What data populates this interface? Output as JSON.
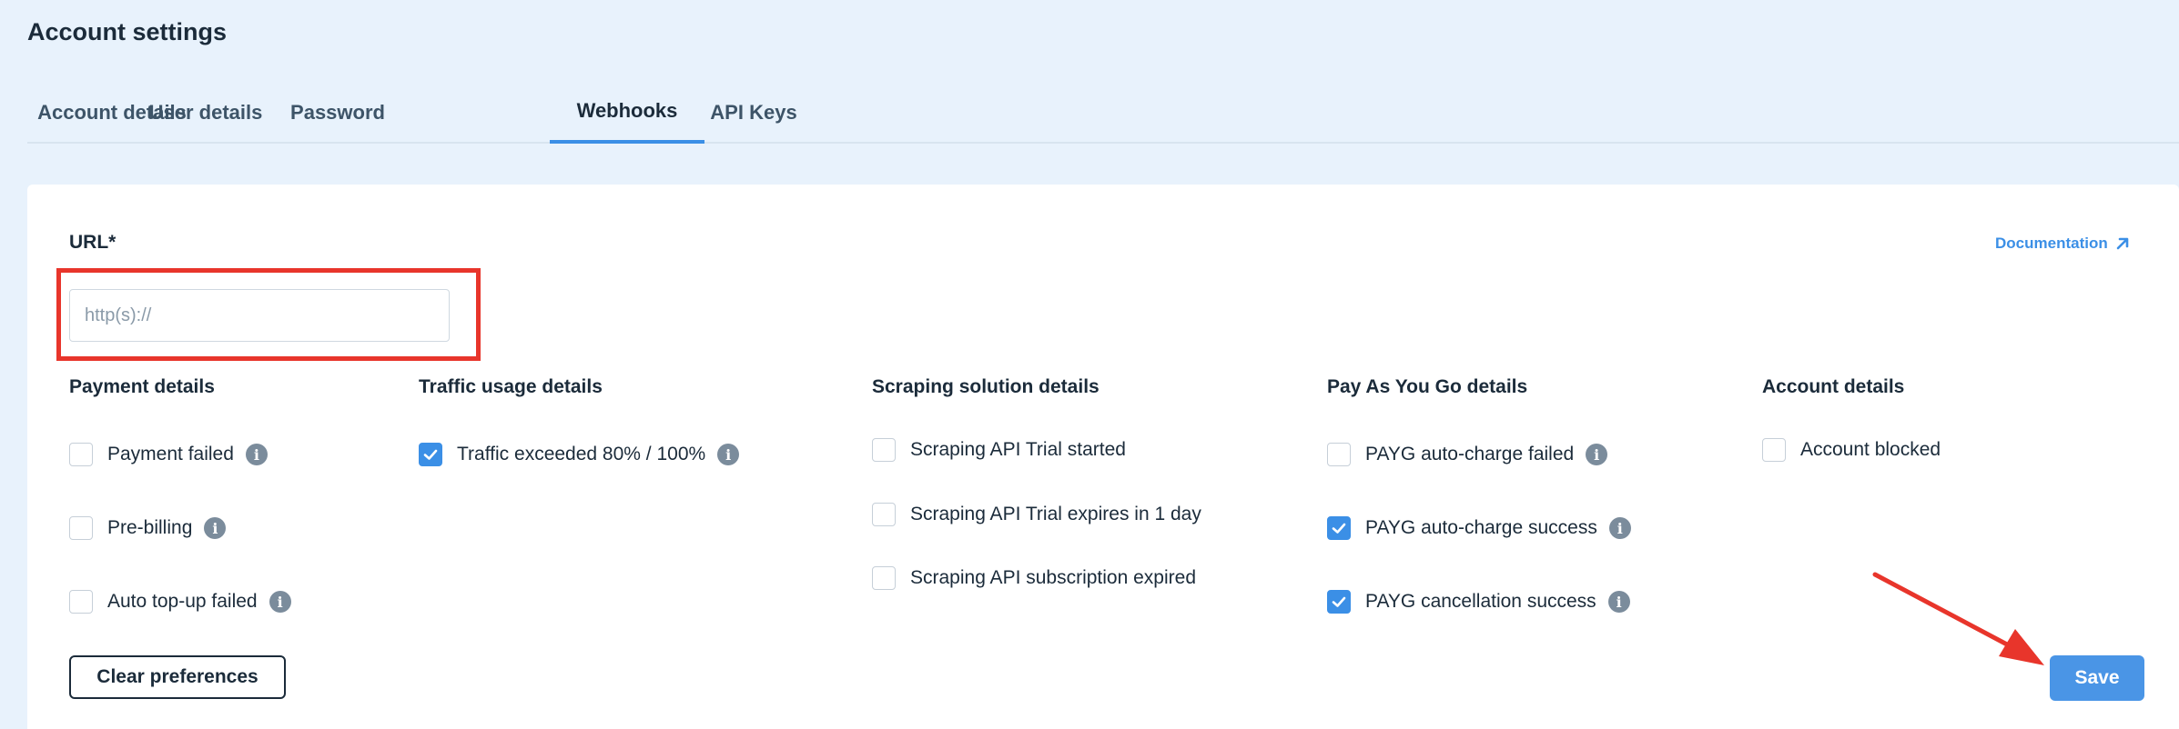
{
  "page": {
    "title": "Account settings"
  },
  "tabs": [
    {
      "label": "Account details",
      "active": false
    },
    {
      "label": "User details",
      "active": false
    },
    {
      "label": "Password",
      "active": false
    },
    {
      "label": "Webhooks",
      "active": true
    },
    {
      "label": "API Keys",
      "active": false
    }
  ],
  "url_field": {
    "label": "URL*",
    "placeholder": "http(s)://",
    "value": ""
  },
  "documentation_link": {
    "label": "Documentation",
    "icon": "arrow-up-right-icon"
  },
  "columns": {
    "payment": {
      "heading": "Payment details",
      "options": [
        {
          "label": "Payment failed",
          "checked": false,
          "info": true
        },
        {
          "label": "Pre-billing",
          "checked": false,
          "info": true
        },
        {
          "label": "Auto top-up failed",
          "checked": false,
          "info": true
        }
      ]
    },
    "traffic": {
      "heading": "Traffic usage details",
      "options": [
        {
          "label": "Traffic exceeded 80% / 100%",
          "checked": true,
          "info": true
        }
      ]
    },
    "scraping": {
      "heading": "Scraping solution details",
      "options": [
        {
          "label": "Scraping API Trial started",
          "checked": false,
          "info": false
        },
        {
          "label": "Scraping API Trial expires in 1 day",
          "checked": false,
          "info": false
        },
        {
          "label": "Scraping API subscription expired",
          "checked": false,
          "info": false
        }
      ]
    },
    "payg": {
      "heading": "Pay As You Go details",
      "options": [
        {
          "label": "PAYG auto-charge failed",
          "checked": false,
          "info": true
        },
        {
          "label": "PAYG auto-charge success",
          "checked": true,
          "info": true
        },
        {
          "label": "PAYG cancellation success",
          "checked": true,
          "info": true
        }
      ]
    },
    "account": {
      "heading": "Account details",
      "options": [
        {
          "label": "Account blocked",
          "checked": false,
          "info": false
        }
      ]
    }
  },
  "buttons": {
    "clear_label": "Clear preferences",
    "save_label": "Save"
  },
  "colors": {
    "accent": "#3b8fe6",
    "annotation_red": "#e8352b",
    "background": "#e8f2fc"
  }
}
